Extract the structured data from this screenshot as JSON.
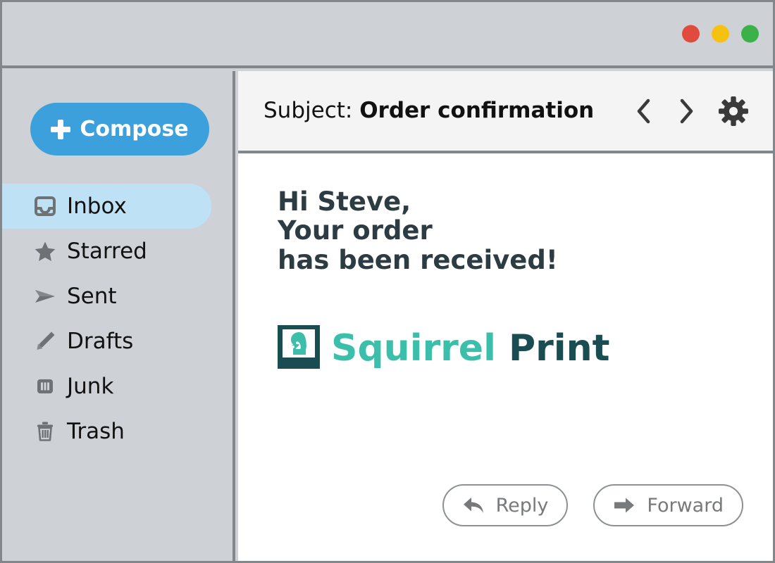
{
  "window": {
    "titlebar": {
      "controls": [
        {
          "name": "close-button",
          "color": "#e04b3e"
        },
        {
          "name": "minimize-button",
          "color": "#f5c211"
        },
        {
          "name": "maximize-button",
          "color": "#3cb14a"
        }
      ]
    },
    "background": "#ced2d7",
    "border_color": "#82878b"
  },
  "sidebar": {
    "compose": {
      "label": "Compose",
      "icon": "plus-icon",
      "color": "#3ba0dc"
    },
    "active_item": "Inbox",
    "highlight_color": "#bfe1f5",
    "items": [
      {
        "label": "Inbox",
        "icon": "inbox-icon",
        "active": true
      },
      {
        "label": "Starred",
        "icon": "star-icon",
        "active": false
      },
      {
        "label": "Sent",
        "icon": "send-icon",
        "active": false
      },
      {
        "label": "Drafts",
        "icon": "pencil-icon",
        "active": false
      },
      {
        "label": "Junk",
        "icon": "junk-icon",
        "active": false
      },
      {
        "label": "Trash",
        "icon": "trash-icon",
        "active": false
      }
    ]
  },
  "reading_pane": {
    "subject": {
      "label": "Subject:",
      "value": "Order confirmation"
    },
    "header_actions": [
      {
        "name": "previous-message-button",
        "icon": "chevron-left-icon"
      },
      {
        "name": "next-message-button",
        "icon": "chevron-right-icon"
      },
      {
        "name": "settings-button",
        "icon": "gear-icon"
      }
    ],
    "message": {
      "lines": [
        "Hi Steve,",
        "Your order",
        "has been received!"
      ],
      "text_color": "#2d3c42"
    },
    "logo": {
      "word1": "Squirrel",
      "word2": "Print",
      "word1_color": "#3bbfab",
      "word2_color": "#1a4d52",
      "mark": "squirrel-logo-icon"
    },
    "actions": [
      {
        "label": "Reply",
        "icon": "reply-arrow-icon"
      },
      {
        "label": "Forward",
        "icon": "forward-arrow-icon"
      }
    ]
  }
}
